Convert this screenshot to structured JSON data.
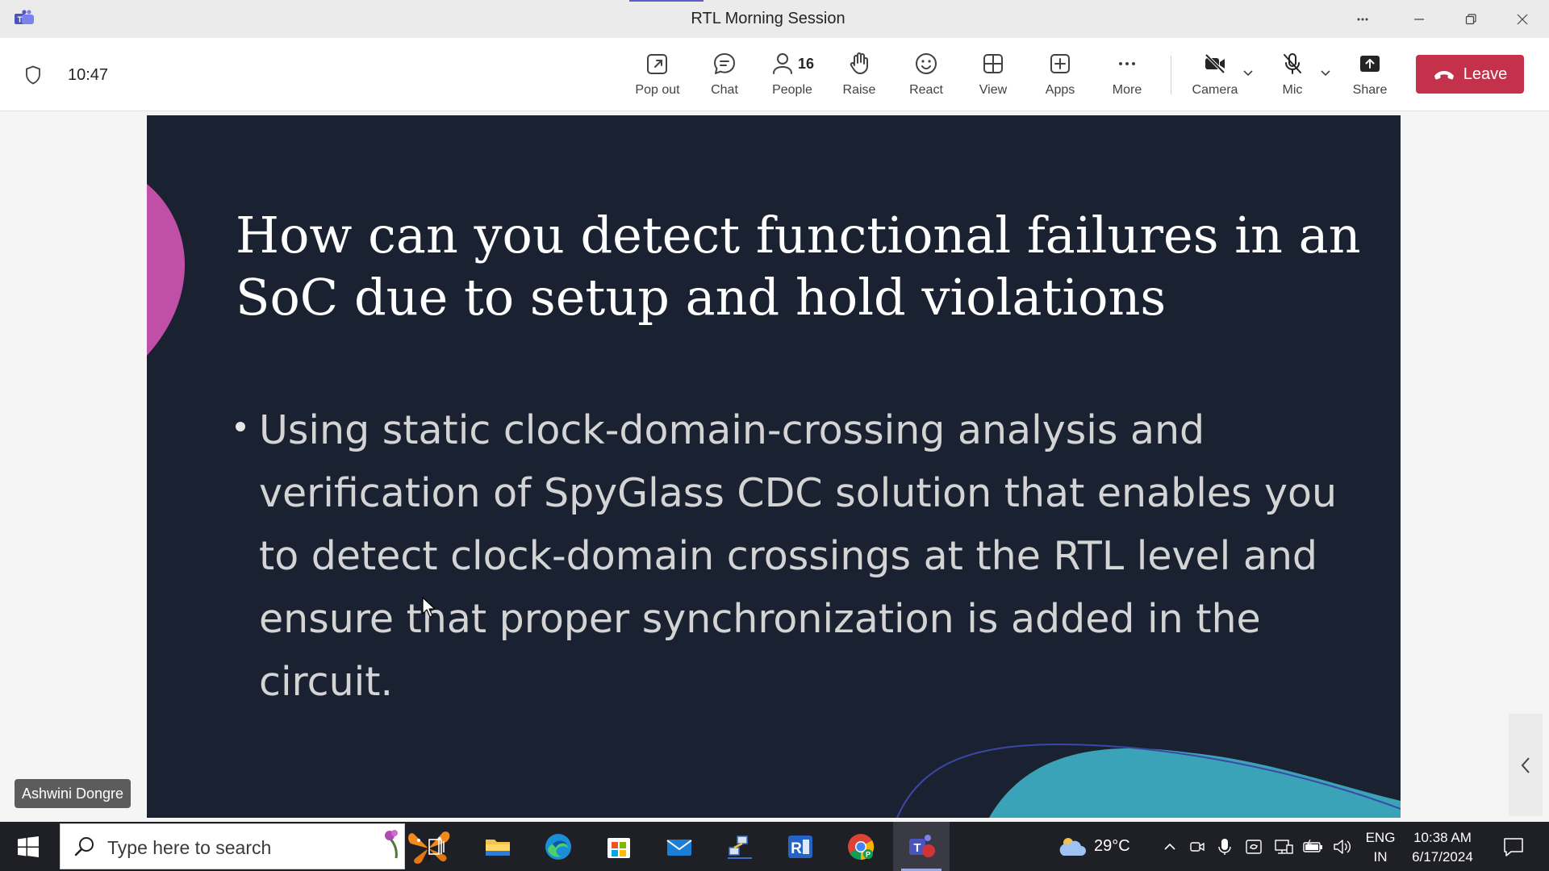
{
  "window": {
    "title": "RTL Morning Session",
    "app_icon": "teams-icon"
  },
  "toolbar": {
    "timer": "10:47",
    "buttons": {
      "popout": {
        "label": "Pop out",
        "icon": "popout-icon"
      },
      "chat": {
        "label": "Chat",
        "icon": "chat-icon"
      },
      "people": {
        "label": "People",
        "icon": "people-icon",
        "count": "16"
      },
      "raise": {
        "label": "Raise",
        "icon": "hand-icon"
      },
      "react": {
        "label": "React",
        "icon": "smile-icon"
      },
      "view": {
        "label": "View",
        "icon": "grid-icon"
      },
      "apps": {
        "label": "Apps",
        "icon": "plus-square-icon"
      },
      "more": {
        "label": "More",
        "icon": "ellipsis-icon"
      },
      "camera": {
        "label": "Camera",
        "icon": "camera-off-icon"
      },
      "mic": {
        "label": "Mic",
        "icon": "mic-off-icon"
      },
      "share": {
        "label": "Share",
        "icon": "share-icon"
      }
    },
    "leave_label": "Leave",
    "leave_color": "#c4314b"
  },
  "slide": {
    "title": "How can you detect functional failures in an SoC due to setup and hold violations",
    "bullet": "Using static clock-domain-crossing analysis and verification of SpyGlass CDC solution that enables you to detect clock-domain crossings at the RTL level and ensure that proper synchronization is added in the circuit.",
    "background": "#1a2232",
    "accent_pink": "#c04fa8",
    "accent_teal": "#3aa3b8"
  },
  "speaker": {
    "name": "Ashwini Dongre"
  },
  "taskbar": {
    "search_placeholder": "Type here to search",
    "weather_temp": "29°C",
    "language": {
      "line1": "ENG",
      "line2": "IN"
    },
    "clock": {
      "time": "10:38 AM",
      "date": "6/17/2024"
    },
    "apps": [
      "task-view-icon",
      "file-explorer-icon",
      "edge-icon",
      "store-icon",
      "mail-icon",
      "network-app-icon",
      "rdp-app-icon",
      "chrome-icon",
      "teams-icon"
    ]
  }
}
